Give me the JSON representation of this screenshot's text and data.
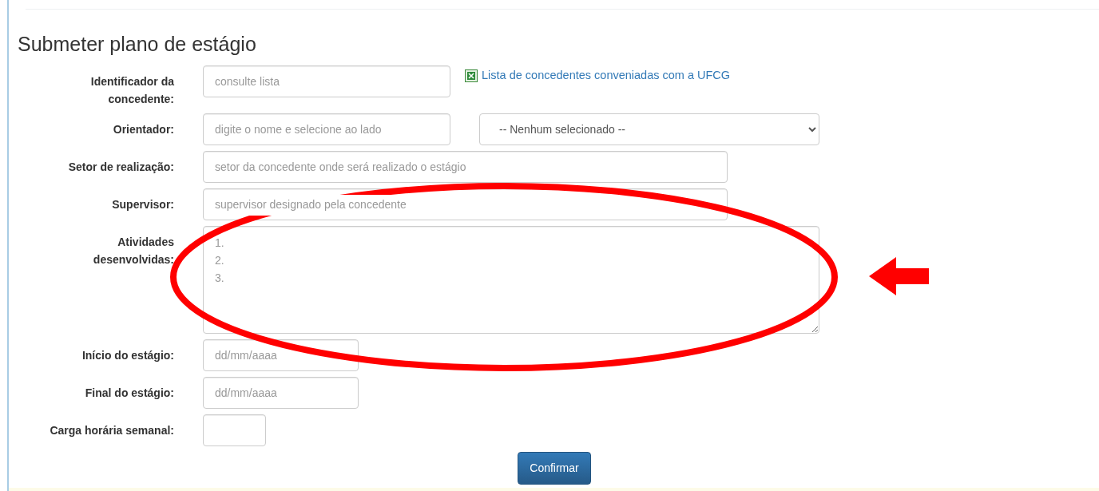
{
  "title": "Submeter plano de estágio",
  "fields": [
    {
      "kind": "text",
      "label": "Identificador da concedente:",
      "placeholder": "consulte lista",
      "link": {
        "text": "Lista de concedentes conveniadas com a UFCG"
      }
    },
    {
      "kind": "text",
      "label": "Orientador:",
      "placeholder": "digite o nome e selecione ao lado",
      "select": {
        "value": "-- Nenhum selecionado --"
      }
    },
    {
      "kind": "text",
      "label": "Setor de realização:",
      "placeholder": "setor da concedente onde será realizado o estágio"
    },
    {
      "kind": "text",
      "label": "Supervisor:",
      "placeholder": "supervisor designado pela concedente"
    },
    {
      "kind": "textarea",
      "label": "Atividades desenvolvidas:",
      "placeholder": "1.\n2.\n3."
    },
    {
      "kind": "text",
      "label": "Início do estágio:",
      "placeholder": "dd/mm/aaaa"
    },
    {
      "kind": "text",
      "label": "Final do estágio:",
      "placeholder": "dd/mm/aaaa"
    },
    {
      "kind": "text",
      "label": "Carga horária semanal:"
    }
  ],
  "submit": "Confirmar"
}
